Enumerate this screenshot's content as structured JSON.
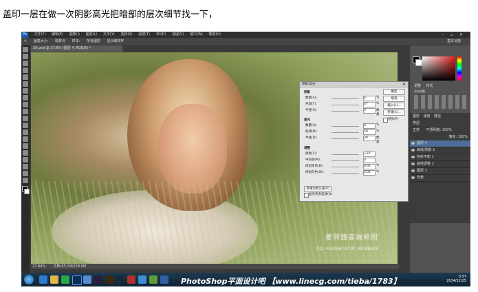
{
  "caption": "盖印一层在做一次阴影高光把暗部的层次细节找一下，",
  "ps": {
    "logo": "Ps",
    "menu": [
      "文件(F)",
      "编辑(E)",
      "图像(I)",
      "图层(L)",
      "文字(Y)",
      "选择(S)",
      "滤镜(T)",
      "3D(D)",
      "视图(V)",
      "窗口(W)",
      "帮助(H)"
    ],
    "options": {
      "size_label": "画笔大小:",
      "mode": "取样点",
      "sample_label": "样本:",
      "sample_value": "所有图层",
      "checkbox": "显示取样环",
      "workspace": "基本功能"
    },
    "doc_tab": "29.psd @ 27.8% (图层 4, RGB/8) *",
    "statusbar": {
      "zoom": "27.84%",
      "doc": "文档:65.1M/229.6M"
    }
  },
  "watermark": {
    "name": "姜同鋒高端修图",
    "contact": "QQ: 454946742    微: 98788628"
  },
  "panels": {
    "tabs": [
      "调整",
      "样式"
    ],
    "adjust_label": "添加调整",
    "layers_tabs": [
      "图层",
      "通道",
      "路径"
    ],
    "kind": "类型",
    "blend": "正常",
    "opacity": "不透明度: 100%",
    "fill": "填充: 100%",
    "layers": [
      {
        "name": "图层 4",
        "selected": true
      },
      {
        "name": "曲线/阴影 1",
        "selected": false
      },
      {
        "name": "色彩平衡 1",
        "selected": false
      },
      {
        "name": "曲线调整 1",
        "selected": false
      },
      {
        "name": "图层 3",
        "selected": false
      },
      {
        "name": "背景",
        "selected": false
      }
    ]
  },
  "dialog": {
    "title": "阴影/高光",
    "shadows_label": "阴影",
    "shadows": [
      {
        "label": "数量(A):",
        "value": "6",
        "unit": "%"
      },
      {
        "label": "色调(T):",
        "value": "47",
        "unit": "%"
      },
      {
        "label": "半径(R):",
        "value": "3",
        "unit": "像素"
      }
    ],
    "highlights_label": "高光",
    "highlights": [
      {
        "label": "数量(U):",
        "value": "0",
        "unit": "%"
      },
      {
        "label": "色调(N):",
        "value": "50",
        "unit": "%"
      },
      {
        "label": "半径(D):",
        "value": "30",
        "unit": "像素"
      }
    ],
    "adjust_label": "调整",
    "adjust": [
      {
        "label": "颜色(C):",
        "value": "+20",
        "unit": ""
      },
      {
        "label": "中间调(M):",
        "value": "0",
        "unit": ""
      },
      {
        "label": "修剪黑色(B):",
        "value": "0.01",
        "unit": "%"
      },
      {
        "label": "修剪白色(W):",
        "value": "0.01",
        "unit": "%"
      }
    ],
    "buttons": {
      "ok": "确定",
      "cancel": "取消",
      "load": "载入(L)...",
      "save": "存储(S)...",
      "preview": "预览(P)"
    },
    "default_button": "存储为默认值(V)",
    "more_options": "显示更多选项(O)"
  },
  "taskbar": {
    "banner": "PhotoShop平面设计吧  【www.linecg.com/tieba/1783】",
    "time": "0:57",
    "date": "2014/12/25"
  }
}
